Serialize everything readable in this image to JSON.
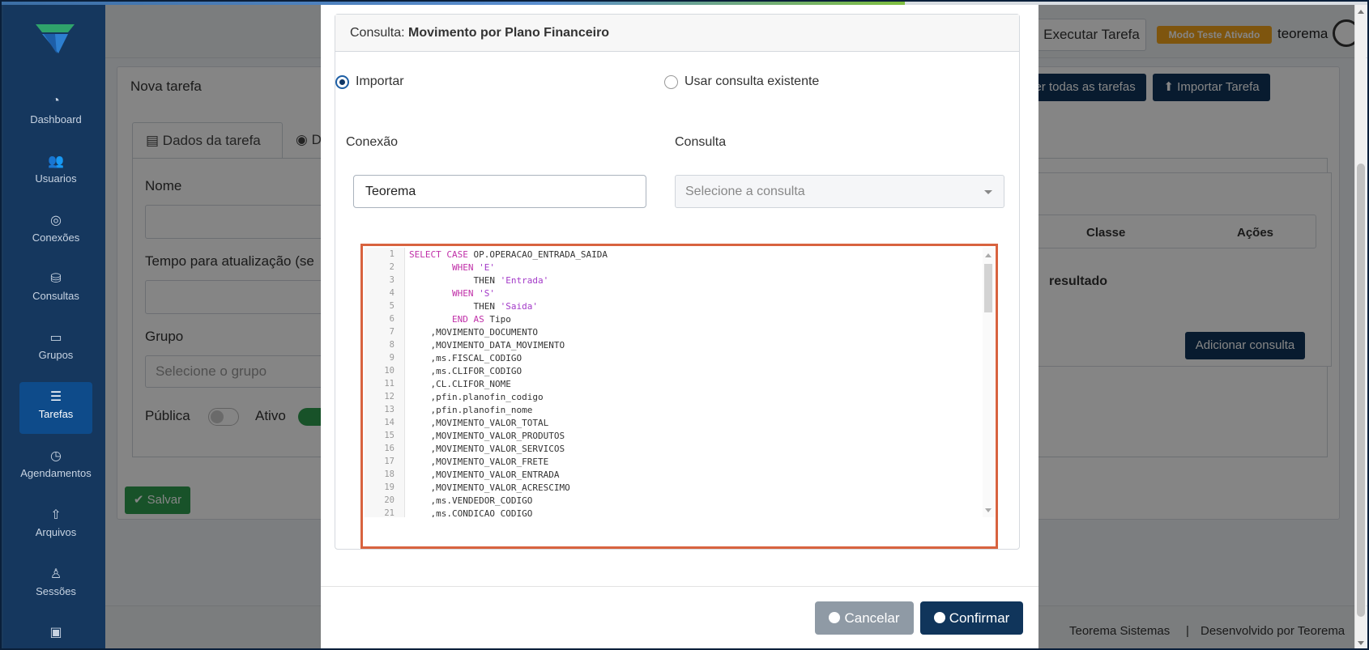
{
  "header": {
    "execute_task": "Executar Tarefa",
    "test_badge": "Modo Teste Ativado",
    "user": "teorema"
  },
  "sidebar": {
    "items": [
      {
        "label": "Dashboard",
        "icon": "dashboard-icon"
      },
      {
        "label": "Usuarios",
        "icon": "users-icon"
      },
      {
        "label": "Conexões",
        "icon": "connections-icon"
      },
      {
        "label": "Consultas",
        "icon": "database-icon"
      },
      {
        "label": "Grupos",
        "icon": "groups-icon"
      },
      {
        "label": "Tarefas",
        "icon": "list-icon",
        "active": true
      },
      {
        "label": "Agendamentos",
        "icon": "clock-icon"
      },
      {
        "label": "Arquivos",
        "icon": "upload-icon"
      },
      {
        "label": "Sessões",
        "icon": "user-icon"
      },
      {
        "label": "",
        "icon": "document-icon"
      }
    ]
  },
  "page": {
    "card_title": "Nova tarefa",
    "view_all_button": "Ver todas as tarefas",
    "import_button": "Importar Tarefa",
    "tab_data": "Dados da tarefa",
    "tab_second": "D",
    "name_label": "Nome",
    "refresh_label": "Tempo para atualização (se",
    "group_label": "Grupo",
    "group_placeholder": "Selecione o grupo",
    "public_label": "Pública",
    "active_label": "Ativo",
    "save_button": "Salvar",
    "col_class": "Classe",
    "col_actions": "Ações",
    "empty_text": "resultado",
    "add_query_button": "Adicionar consulta"
  },
  "footer": {
    "company": "Teorema Sistemas",
    "separator": "|",
    "developed_by": "Desenvolvido por Teorema"
  },
  "modal": {
    "title_prefix": "Consulta:",
    "title": "Movimento por Plano Financeiro",
    "radio_import": "Importar",
    "radio_existing": "Usar consulta existente",
    "connection_label": "Conexão",
    "connection_value": "Teorema",
    "query_label": "Consulta",
    "query_placeholder": "Selecione a consulta",
    "cancel_button": "Cancelar",
    "confirm_button": "Confirmar",
    "code_lines": [
      {
        "n": "1",
        "indent": "",
        "parts": [
          [
            "kw",
            "SELECT CASE "
          ],
          [
            "plain",
            "OP.OPERACAO_ENTRADA_SAIDA"
          ]
        ]
      },
      {
        "n": "2",
        "indent": "        ",
        "parts": [
          [
            "kw",
            "WHEN "
          ],
          [
            "str",
            "'E'"
          ]
        ]
      },
      {
        "n": "3",
        "indent": "            ",
        "parts": [
          [
            "plain",
            "THEN "
          ],
          [
            "str",
            "'Entrada'"
          ]
        ]
      },
      {
        "n": "4",
        "indent": "        ",
        "parts": [
          [
            "kw",
            "WHEN "
          ],
          [
            "str",
            "'S'"
          ]
        ]
      },
      {
        "n": "5",
        "indent": "            ",
        "parts": [
          [
            "plain",
            "THEN "
          ],
          [
            "str",
            "'Saida'"
          ]
        ]
      },
      {
        "n": "6",
        "indent": "        ",
        "parts": [
          [
            "kw",
            "END AS "
          ],
          [
            "plain",
            "Tipo"
          ]
        ]
      },
      {
        "n": "7",
        "indent": "    ",
        "parts": [
          [
            "plain",
            ",MOVIMENTO_DOCUMENTO"
          ]
        ]
      },
      {
        "n": "8",
        "indent": "    ",
        "parts": [
          [
            "plain",
            ",MOVIMENTO_DATA_MOVIMENTO"
          ]
        ]
      },
      {
        "n": "9",
        "indent": "    ",
        "parts": [
          [
            "plain",
            ",ms.FISCAL_CODIGO"
          ]
        ]
      },
      {
        "n": "10",
        "indent": "    ",
        "parts": [
          [
            "plain",
            ",ms.CLIFOR_CODIGO"
          ]
        ]
      },
      {
        "n": "11",
        "indent": "    ",
        "parts": [
          [
            "plain",
            ",CL.CLIFOR_NOME"
          ]
        ]
      },
      {
        "n": "12",
        "indent": "    ",
        "parts": [
          [
            "plain",
            ",pfin.planofin_codigo"
          ]
        ]
      },
      {
        "n": "13",
        "indent": "    ",
        "parts": [
          [
            "plain",
            ",pfin.planofin_nome"
          ]
        ]
      },
      {
        "n": "14",
        "indent": "    ",
        "parts": [
          [
            "plain",
            ",MOVIMENTO_VALOR_TOTAL"
          ]
        ]
      },
      {
        "n": "15",
        "indent": "    ",
        "parts": [
          [
            "plain",
            ",MOVIMENTO_VALOR_PRODUTOS"
          ]
        ]
      },
      {
        "n": "16",
        "indent": "    ",
        "parts": [
          [
            "plain",
            ",MOVIMENTO_VALOR_SERVICOS"
          ]
        ]
      },
      {
        "n": "17",
        "indent": "    ",
        "parts": [
          [
            "plain",
            ",MOVIMENTO_VALOR_FRETE"
          ]
        ]
      },
      {
        "n": "18",
        "indent": "    ",
        "parts": [
          [
            "plain",
            ",MOVIMENTO_VALOR_ENTRADA"
          ]
        ]
      },
      {
        "n": "19",
        "indent": "    ",
        "parts": [
          [
            "plain",
            ",MOVIMENTO_VALOR_ACRESCIMO"
          ]
        ]
      },
      {
        "n": "20",
        "indent": "    ",
        "parts": [
          [
            "plain",
            ",ms.VENDEDOR_CODIGO"
          ]
        ]
      },
      {
        "n": "21",
        "indent": "    ",
        "parts": [
          [
            "plain",
            ",ms.CONDICAO_CODIGO"
          ]
        ]
      }
    ]
  },
  "colors": {
    "navy": "#10355b",
    "sidebar": "#15375e",
    "highlight_border": "#d8633f",
    "save_green": "#2e9e4f",
    "badge": "#f2a31b",
    "cancel_gray": "#8f9aa5"
  }
}
